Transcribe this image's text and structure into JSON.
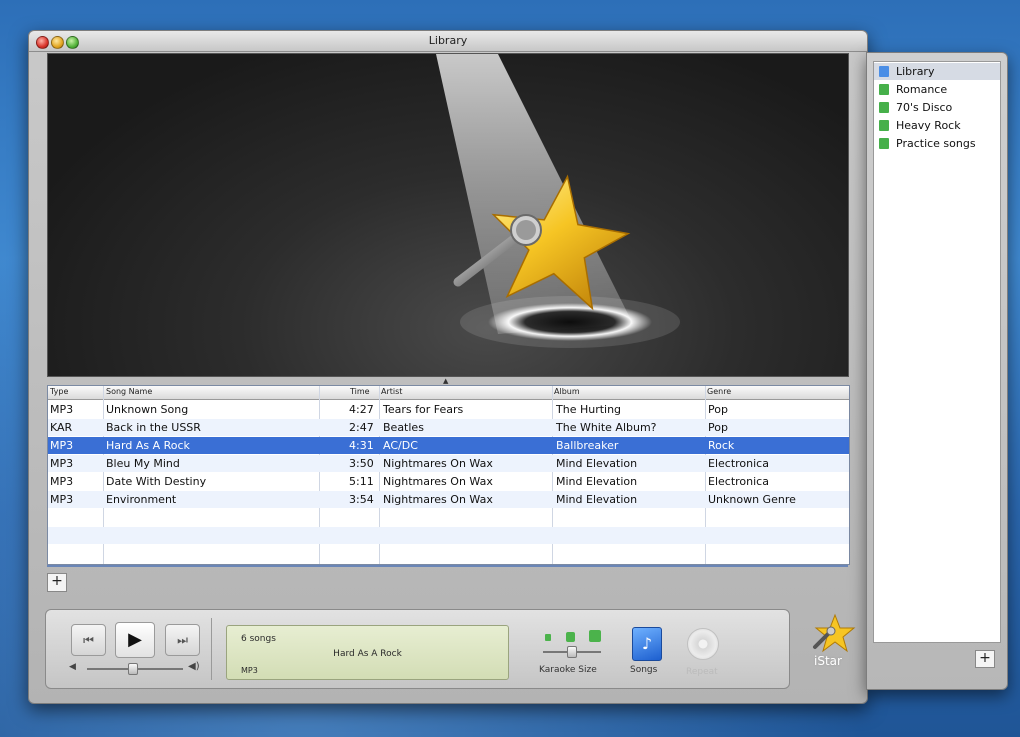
{
  "window": {
    "title": "Library"
  },
  "table": {
    "headers": {
      "type": "Type",
      "song": "Song Name",
      "time": "Time",
      "artist": "Artist",
      "album": "Album",
      "genre": "Genre"
    },
    "rows": [
      {
        "type": "MP3",
        "song": "Unknown Song",
        "time": "4:27",
        "artist": "Tears for Fears",
        "album": "The Hurting",
        "genre": "Pop"
      },
      {
        "type": "KAR",
        "song": "Back in the USSR",
        "time": "2:47",
        "artist": "Beatles",
        "album": "The White Album?",
        "genre": "Pop"
      },
      {
        "type": "MP3",
        "song": "Hard As A Rock",
        "time": "4:31",
        "artist": "AC/DC",
        "album": "Ballbreaker",
        "genre": "Rock"
      },
      {
        "type": "MP3",
        "song": "Bleu My Mind",
        "time": "3:50",
        "artist": "Nightmares On Wax",
        "album": "Mind Elevation",
        "genre": "Electronica"
      },
      {
        "type": "MP3",
        "song": "Date With Destiny",
        "time": "5:11",
        "artist": "Nightmares On Wax",
        "album": "Mind Elevation",
        "genre": "Electronica"
      },
      {
        "type": "MP3",
        "song": "Environment",
        "time": "3:54",
        "artist": "Nightmares On Wax",
        "album": "Mind Elevation",
        "genre": "Unknown Genre"
      }
    ],
    "selected_row": 2
  },
  "controls": {
    "add_label": "+",
    "prev_glyph": "⏮",
    "play_glyph": "▶",
    "next_glyph": "⏭",
    "karaoke_size_label": "Karaoke Size",
    "songs_label": "Songs",
    "repeat_label": "Repeat"
  },
  "display": {
    "song_count": "6 songs",
    "now_playing": "Hard As A Rock",
    "format": "MP3"
  },
  "playlists": {
    "items": [
      {
        "label": "Library",
        "color": "#4a8ee6"
      },
      {
        "label": "Romance",
        "color": "#46b04a"
      },
      {
        "label": "70's Disco",
        "color": "#46b04a"
      },
      {
        "label": "Heavy Rock",
        "color": "#46b04a"
      },
      {
        "label": "Practice songs",
        "color": "#46b04a"
      }
    ],
    "selected": 0,
    "add_label": "+"
  },
  "brand": {
    "name": "iStar"
  }
}
